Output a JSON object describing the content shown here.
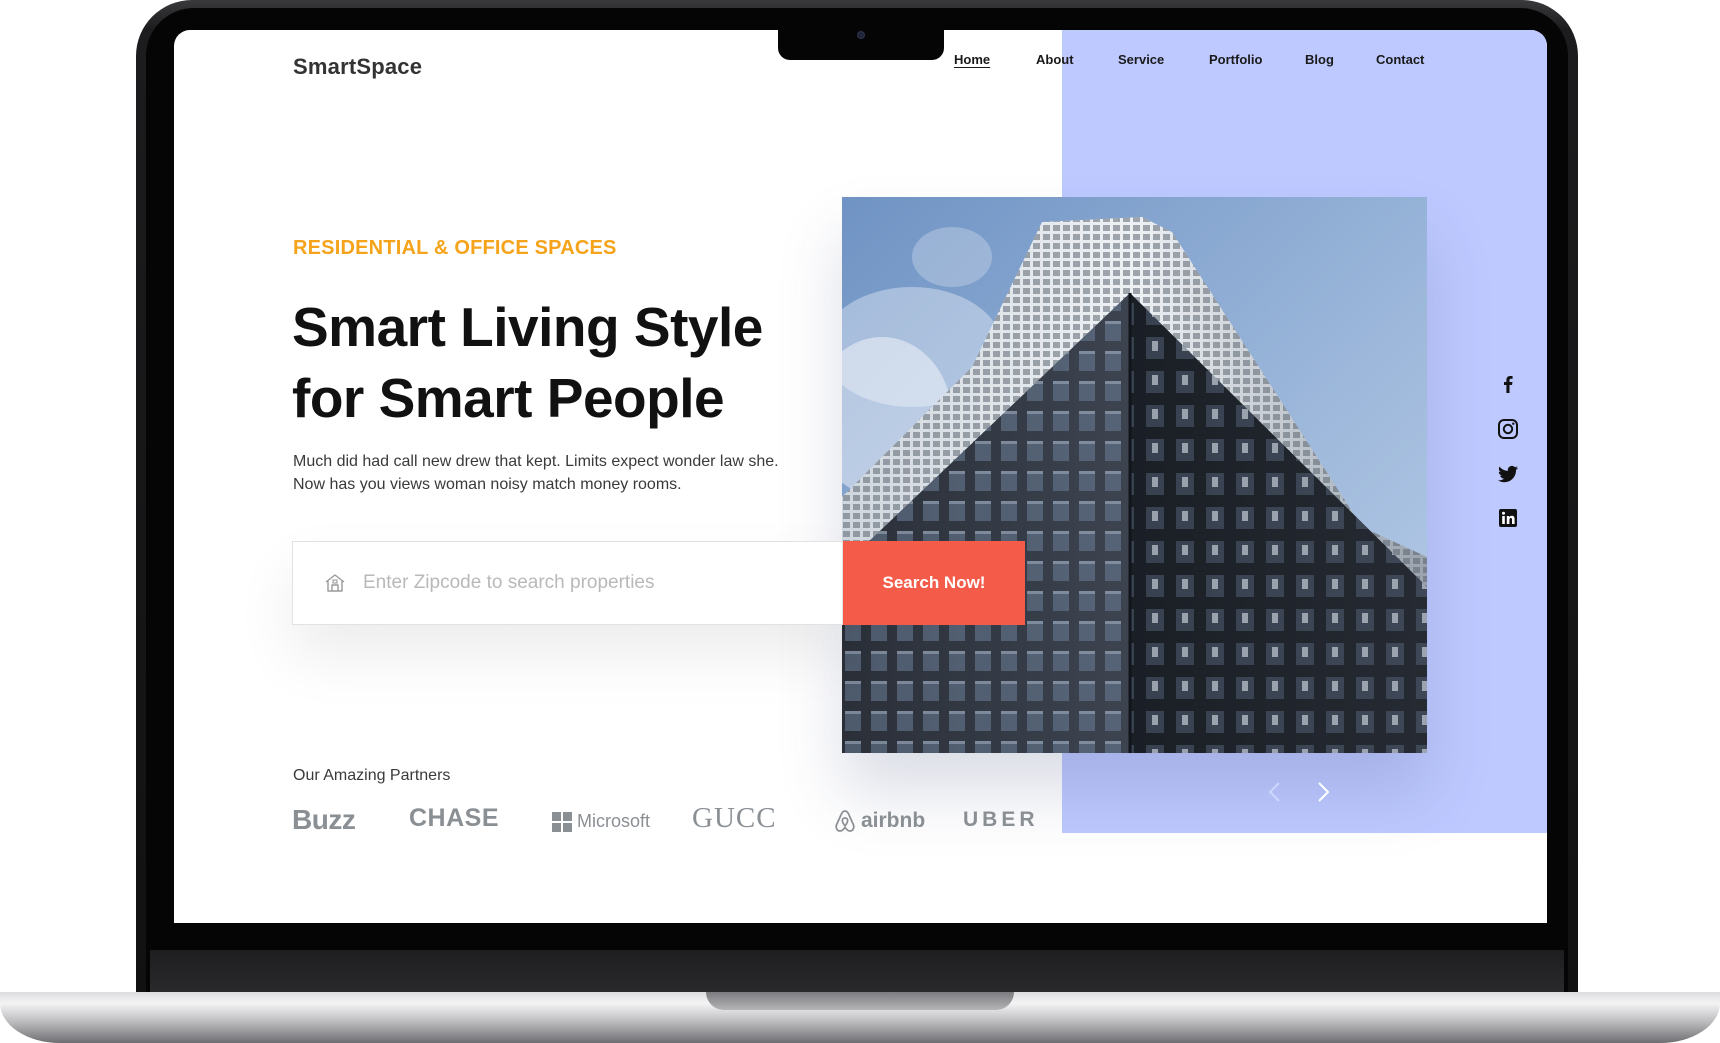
{
  "brand": {
    "name": "SmartSpace"
  },
  "nav": {
    "items": [
      {
        "label": "Home",
        "active": true
      },
      {
        "label": "About",
        "active": false
      },
      {
        "label": "Service",
        "active": false
      },
      {
        "label": "Portfolio",
        "active": false
      },
      {
        "label": "Blog",
        "active": false
      },
      {
        "label": "Contact",
        "active": false
      }
    ]
  },
  "hero": {
    "eyebrow": "RESIDENTIAL & OFFICE SPACES",
    "headline_line1": "Smart Living Style",
    "headline_line2": "for Smart People",
    "description": "Much did had call new drew that kept. Limits expect wonder law she. Now has you views woman noisy match money rooms.",
    "image_icon": "skyscraper-photo"
  },
  "search": {
    "placeholder": "Enter Zipcode to search properties",
    "value": "",
    "icon": "home-icon",
    "button_label": "Search Now!"
  },
  "social": [
    "facebook-icon",
    "instagram-icon",
    "twitter-icon",
    "linkedin-icon"
  ],
  "partners": {
    "label": "Our Amazing Partners",
    "logos": [
      "Buzz",
      "CHASE",
      "Microsoft",
      "GUCC",
      "airbnb",
      "UBER"
    ]
  },
  "carousel": {
    "prev_icon": "chevron-left-icon",
    "next_icon": "chevron-right-icon"
  },
  "colors": {
    "accent_orange": "#f5a31a",
    "button_red": "#f45b48",
    "panel_lavender": "#bdc9ff",
    "text_dark": "#111111",
    "partner_gray": "#8a8f94"
  }
}
